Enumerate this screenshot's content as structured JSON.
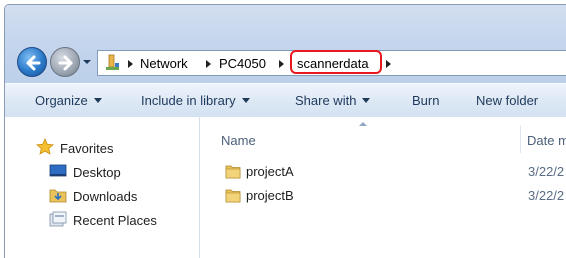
{
  "nav": {
    "back_icon": "back-arrow-icon",
    "forward_icon": "forward-arrow-icon"
  },
  "address_bar": {
    "icon": "network-icon",
    "crumbs": [
      "Network",
      "PC4050",
      "scannerdata"
    ],
    "highlighted_crumb": "scannerdata",
    "highlight_color": "#e8181f"
  },
  "toolbar": {
    "organize": "Organize",
    "include_in_library": "Include in library",
    "share_with": "Share with",
    "burn": "Burn",
    "new_folder": "New folder"
  },
  "sidebar": {
    "favorites": "Favorites",
    "items": [
      {
        "label": "Desktop",
        "icon": "desktop-icon"
      },
      {
        "label": "Downloads",
        "icon": "folder-download-icon"
      },
      {
        "label": "Recent Places",
        "icon": "recent-places-icon"
      }
    ]
  },
  "file_list": {
    "columns": {
      "name": "Name",
      "date": "Date m"
    },
    "rows": [
      {
        "name": "projectA",
        "date": "3/22/2",
        "icon": "folder-icon"
      },
      {
        "name": "projectB",
        "date": "3/22/2",
        "icon": "folder-icon"
      }
    ]
  },
  "colors": {
    "titlebar": "#c4d5ec",
    "toolbar": "#dde8f5",
    "toolbar_text": "#1e395b",
    "highlight": "#e8181f"
  }
}
